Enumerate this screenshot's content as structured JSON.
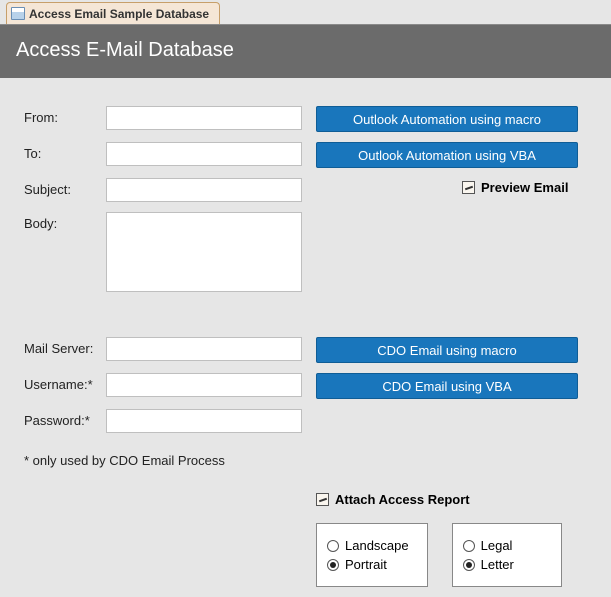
{
  "tab": {
    "title": "Access Email Sample Database"
  },
  "header": {
    "title": "Access E-Mail Database"
  },
  "emailForm": {
    "labels": {
      "from": "From:",
      "to": "To:",
      "subject": "Subject:",
      "body": "Body:"
    },
    "values": {
      "from": "",
      "to": "",
      "subject": "",
      "body": ""
    }
  },
  "outlookButtons": {
    "macro": "Outlook Automation using macro",
    "vba": "Outlook Automation using VBA"
  },
  "previewCheckbox": {
    "label": "Preview Email",
    "checked": true
  },
  "serverForm": {
    "labels": {
      "mailServer": "Mail Server:",
      "username": "Username:*",
      "password": "Password:*"
    },
    "values": {
      "mailServer": "",
      "username": "",
      "password": ""
    }
  },
  "cdoButtons": {
    "macro": "CDO Email using macro",
    "vba": "CDO Email using VBA"
  },
  "footnote": "* only used by CDO Email Process",
  "attach": {
    "label": "Attach Access Report",
    "checked": true
  },
  "orientation": {
    "options": [
      {
        "label": "Landscape",
        "selected": false
      },
      {
        "label": "Portrait",
        "selected": true
      }
    ]
  },
  "paper": {
    "options": [
      {
        "label": "Legal",
        "selected": false
      },
      {
        "label": "Letter",
        "selected": true
      }
    ]
  }
}
